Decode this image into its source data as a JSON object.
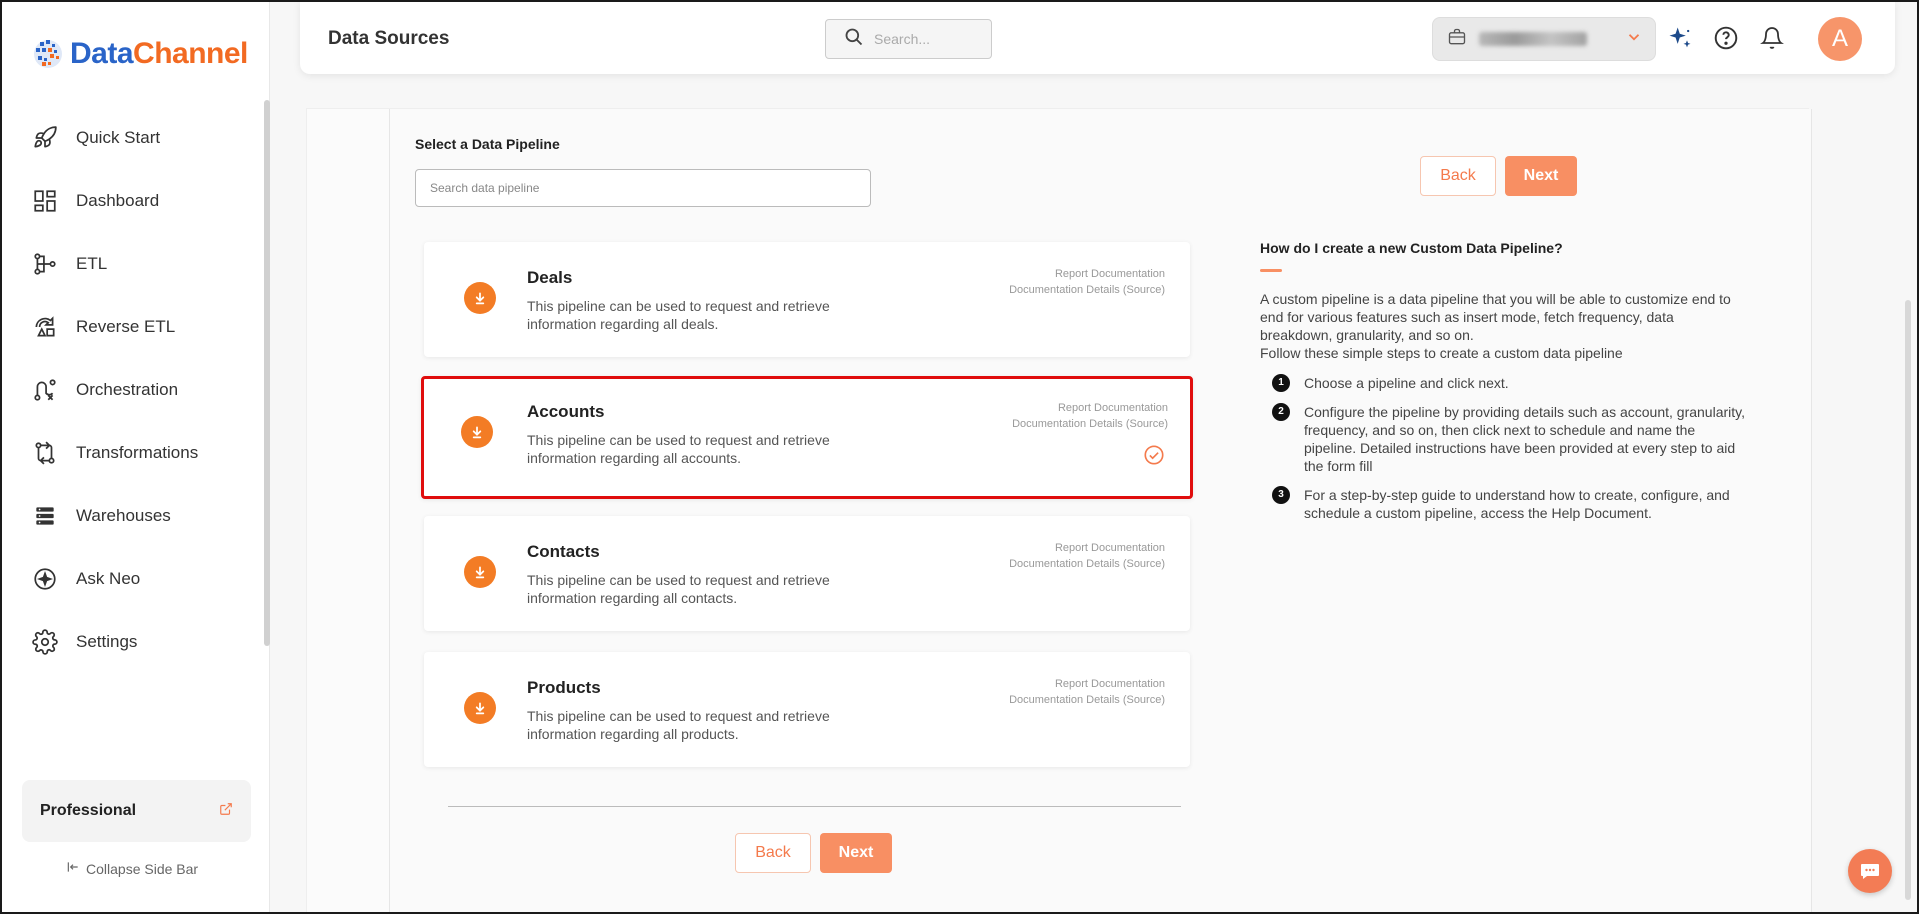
{
  "app": {
    "brand_part1": "Data",
    "brand_part2": "Channel"
  },
  "sidebar": {
    "items": [
      {
        "label": "Quick Start",
        "icon": "rocket-icon"
      },
      {
        "label": "Dashboard",
        "icon": "dashboard-grid-icon"
      },
      {
        "label": "ETL",
        "icon": "etl-flow-icon"
      },
      {
        "label": "Reverse ETL",
        "icon": "reverse-etl-icon"
      },
      {
        "label": "Orchestration",
        "icon": "orchestration-icon"
      },
      {
        "label": "Transformations",
        "icon": "transformations-icon"
      },
      {
        "label": "Warehouses",
        "icon": "warehouse-stack-icon"
      },
      {
        "label": "Ask Neo",
        "icon": "sparkle-circle-icon"
      },
      {
        "label": "Settings",
        "icon": "gear-icon"
      }
    ],
    "plan_label": "Professional",
    "collapse_label": "Collapse Side Bar"
  },
  "header": {
    "title": "Data Sources",
    "search_placeholder": "Search..."
  },
  "main": {
    "select_label": "Select a Data Pipeline",
    "pipeline_search_placeholder": "Search data pipeline",
    "back_label": "Back",
    "next_label": "Next",
    "report_doc_label": "Report Documentation",
    "doc_details_label": "Documentation Details (Source)",
    "pipelines": [
      {
        "title": "Deals",
        "desc": "This pipeline can be used to request and retrieve information regarding all deals.",
        "selected": false
      },
      {
        "title": "Accounts",
        "desc": "This pipeline can be used to request and retrieve information regarding all accounts.",
        "selected": true
      },
      {
        "title": "Contacts",
        "desc": "This pipeline can be used to request and retrieve information regarding all contacts.",
        "selected": false
      },
      {
        "title": "Products",
        "desc": "This pipeline can be used to request and retrieve information regarding all products.",
        "selected": false
      }
    ]
  },
  "help": {
    "title": "How do I create a new Custom Data Pipeline?",
    "intro": "A custom pipeline is a data pipeline that you will be able to customize end to end for various features such as insert mode, fetch frequency, data breakdown, granularity, and so on.",
    "follow": "Follow these simple steps to create a custom data pipeline",
    "steps": [
      {
        "num": "1",
        "text": "Choose a pipeline and click next."
      },
      {
        "num": "2",
        "text": "Configure the pipeline by providing details such as account, granularity, frequency, and so on, then click next to schedule and name the pipeline. Detailed instructions have been provided at every step to aid the form fill"
      },
      {
        "num": "3",
        "text": "For a step-by-step guide to understand how to create, configure, and schedule a custom pipeline, access the Help Document."
      }
    ]
  },
  "colors": {
    "accent": "#f88f63",
    "selected_border": "#e00d0d",
    "icon_orange": "#f37c25",
    "avatar_bg": "#f7956a"
  },
  "user": {
    "avatar_initial": "A"
  }
}
